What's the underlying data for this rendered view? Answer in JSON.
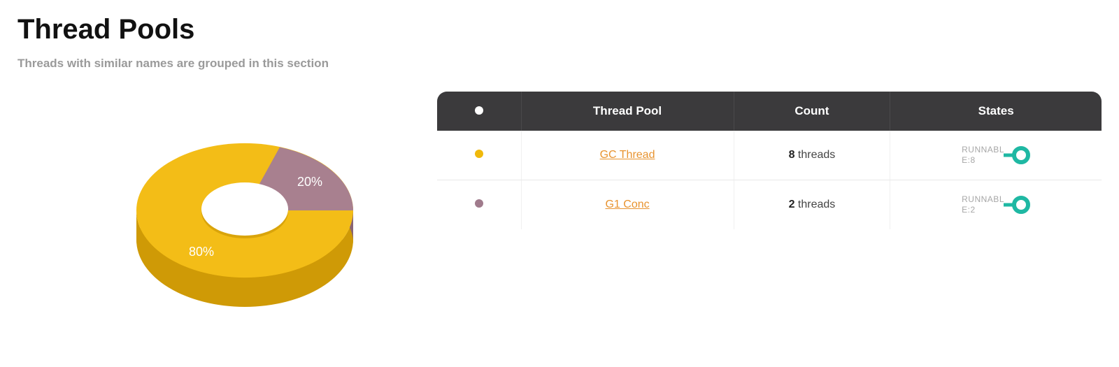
{
  "header": {
    "title": "Thread Pools",
    "subtitle": "Threads with similar names are grouped in this section"
  },
  "table": {
    "columns": {
      "dot": "●",
      "pool": "Thread Pool",
      "count": "Count",
      "states": "States"
    },
    "rows": [
      {
        "color": "#f0b90b",
        "pool": "GC Thread",
        "count": "8",
        "count_suffix": " threads",
        "state_label": "RUNNABLE:8"
      },
      {
        "color": "#a07b8c",
        "pool": "G1 Conc",
        "count": "2",
        "count_suffix": " threads",
        "state_label": "RUNNABLE:2"
      }
    ]
  },
  "chart_data": {
    "type": "pie",
    "title": "",
    "series": [
      {
        "name": "GC Thread",
        "value": 80,
        "label": "80%",
        "color": "#f0b90b"
      },
      {
        "name": "G1 Conc",
        "value": 20,
        "label": "20%",
        "color": "#a07b8c"
      }
    ]
  }
}
